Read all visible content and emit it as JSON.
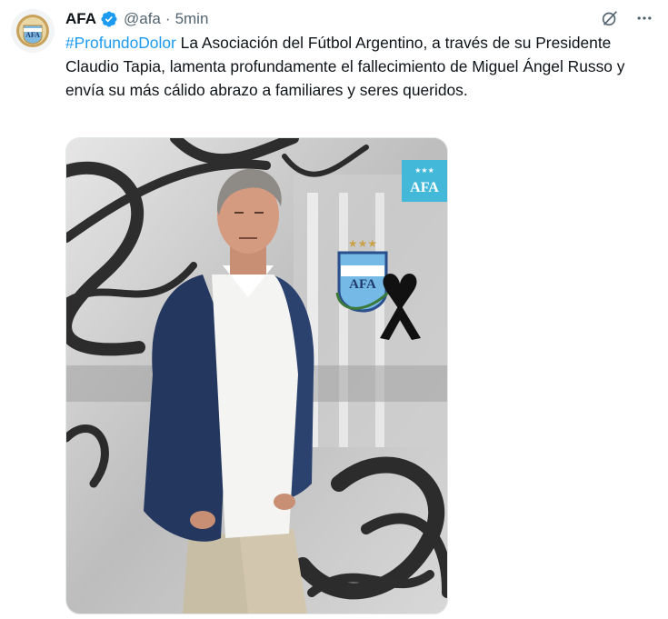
{
  "tweet": {
    "author_name": "AFA",
    "handle": "@afa",
    "separator": "·",
    "time": "5min",
    "hashtag": "#ProfundoDolor",
    "body": " La Asociación del Fútbol Argentino, a través de su Presidente Claudio Tapia, lamenta profundamente el fallecimiento de Miguel Ángel Russo y envía su más cálido abrazo a familiares y seres queridos.",
    "avatar_logo_text": "AFA",
    "media": {
      "badge_text": "AFA",
      "crest_text": "AFA"
    }
  },
  "icons": {
    "verified": "verified-badge-icon",
    "grok": "grok-icon",
    "more": "more-icon"
  },
  "colors": {
    "accent": "#1d9bf0",
    "secondary_text": "#536471",
    "badge": "#43b8d9"
  }
}
